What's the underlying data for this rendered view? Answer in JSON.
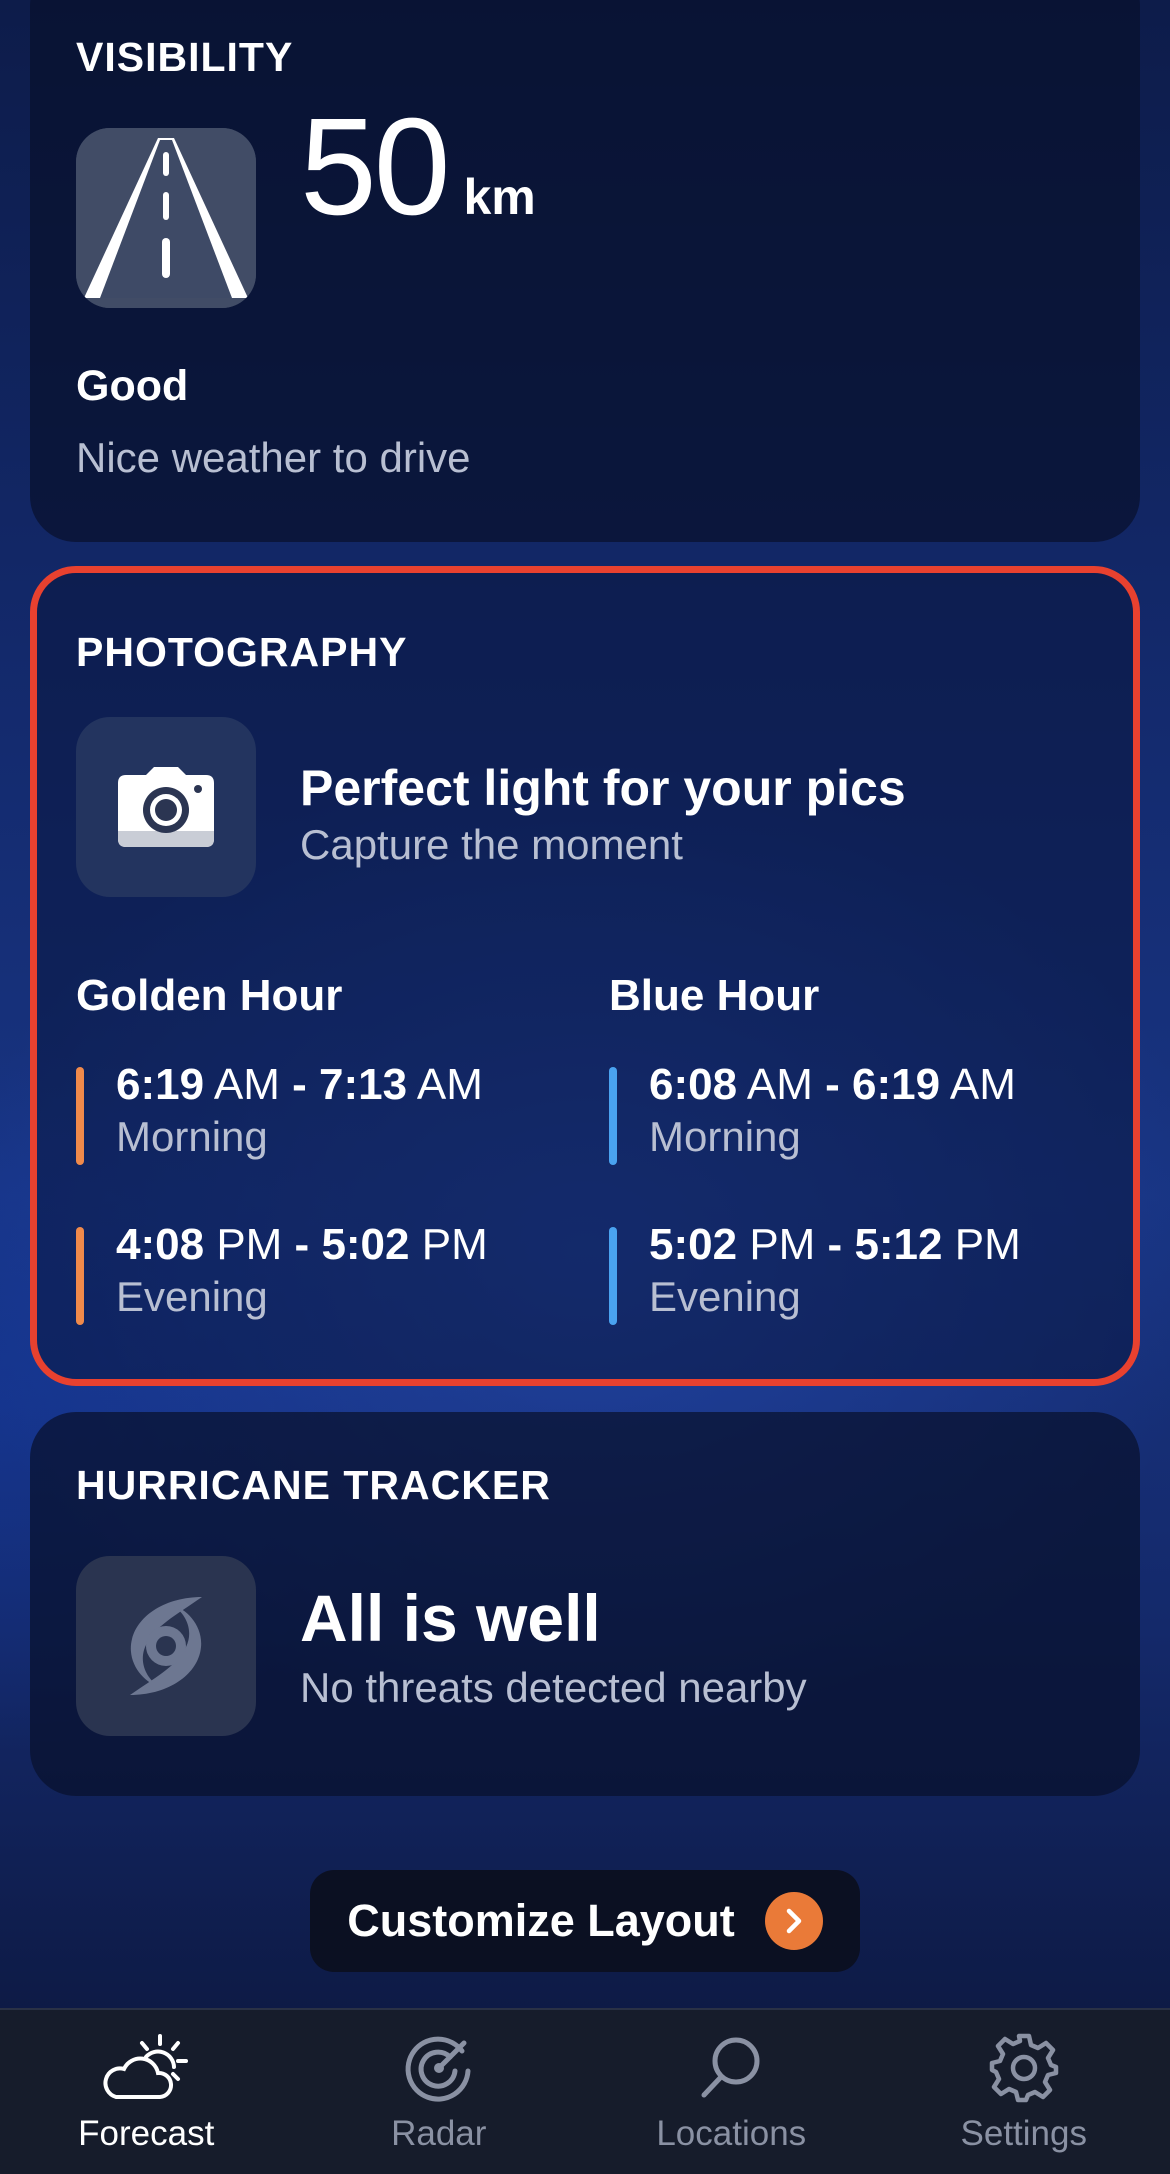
{
  "visibility": {
    "title": "VISIBILITY",
    "value": "50",
    "unit": "km",
    "status": "Good",
    "description": "Nice weather to drive"
  },
  "photography": {
    "title": "PHOTOGRAPHY",
    "headline": "Perfect light for your pics",
    "subline": "Capture the moment",
    "golden_hour": {
      "title": "Golden Hour",
      "accent": "#f08a4b",
      "slots": [
        {
          "start": "6:19",
          "start_ampm": "AM",
          "end": "7:13",
          "end_ampm": "AM",
          "label": "Morning"
        },
        {
          "start": "4:08",
          "start_ampm": "PM",
          "end": "5:02",
          "end_ampm": "PM",
          "label": "Evening"
        }
      ]
    },
    "blue_hour": {
      "title": "Blue Hour",
      "accent": "#4aa3f0",
      "slots": [
        {
          "start": "6:08",
          "start_ampm": "AM",
          "end": "6:19",
          "end_ampm": "AM",
          "label": "Morning"
        },
        {
          "start": "5:02",
          "start_ampm": "PM",
          "end": "5:12",
          "end_ampm": "PM",
          "label": "Evening"
        }
      ]
    },
    "highlight_color": "#e8412f"
  },
  "hurricane": {
    "title": "HURRICANE TRACKER",
    "headline": "All is well",
    "subline": "No threats detected nearby"
  },
  "customize": {
    "label": "Customize Layout",
    "accent": "#ea7a38"
  },
  "tabbar": {
    "tabs": [
      {
        "label": "Forecast",
        "icon": "partly-cloudy-icon",
        "active": true
      },
      {
        "label": "Radar",
        "icon": "radar-icon",
        "active": false
      },
      {
        "label": "Locations",
        "icon": "search-icon",
        "active": false
      },
      {
        "label": "Settings",
        "icon": "gear-icon",
        "active": false
      }
    ]
  }
}
